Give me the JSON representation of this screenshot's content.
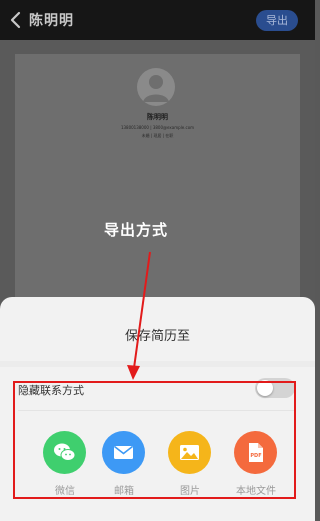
{
  "header": {
    "title": "陈明明",
    "export_label": "导出"
  },
  "resume": {
    "name": "陈明明",
    "contact": "13800138000 | 3800@example.com",
    "info": "未婚 | 现居 | 在职"
  },
  "annotation": {
    "label": "导出方式"
  },
  "sheet": {
    "title": "保存简历至",
    "hide_contact_label": "隐藏联系方式",
    "hide_contact_on": false,
    "options": [
      {
        "label": "微信",
        "icon": "wechat-icon",
        "color": "#3fcf6e"
      },
      {
        "label": "邮箱",
        "icon": "mail-icon",
        "color": "#3d99f5"
      },
      {
        "label": "图片",
        "icon": "image-icon",
        "color": "#f5b51a"
      },
      {
        "label": "本地文件",
        "icon": "pdf-file-icon",
        "color": "#f46a3d"
      }
    ]
  },
  "colors": {
    "highlight_box": "#e21b1b",
    "arrow": "#e21b1b",
    "export_button": "#2a4d8f"
  }
}
